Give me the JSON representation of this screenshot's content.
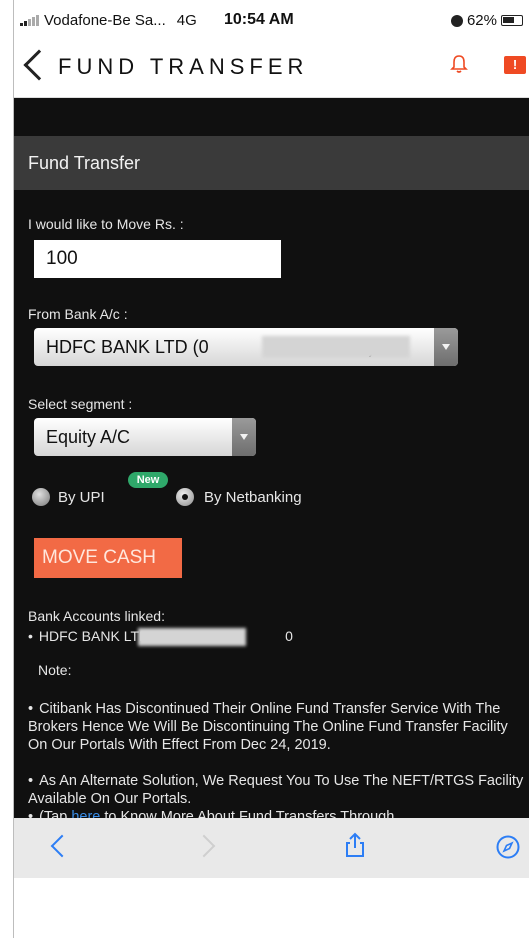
{
  "status_bar": {
    "carrier": "Vodafone-Be Sa...",
    "network": "4G",
    "time": "10:54 AM",
    "battery": "62%"
  },
  "nav": {
    "title": "FUND TRANSFER"
  },
  "form": {
    "section_title": "Fund Transfer",
    "amount_label": "I would like to Move Rs. :",
    "amount_value": "100",
    "from_bank_label": "From Bank A/c :",
    "from_bank_prefix": "HDFC BANK LTD (0",
    "from_bank_suffix": "0)",
    "segment_label": "Select segment :",
    "segment_value": "Equity A/C",
    "radio_upi_label": "By UPI",
    "new_badge": "New",
    "radio_netbanking_label": "By Netbanking",
    "move_cash_label": "MOVE CASH"
  },
  "linked": {
    "heading": "Bank Accounts linked:",
    "account_prefix": "HDFC BANK LTD - 00",
    "account_suffix": "0"
  },
  "note": {
    "heading": "Note:",
    "para1": "Citibank Has Discontinued Their Online Fund Transfer Service With The Brokers Hence We Will Be Discontinuing The Online Fund Transfer Facility On Our Portals With Effect From Dec 24, 2019.",
    "para2": "As An Alternate Solution, We Request You To Use The NEFT/RTGS Facility Available On Our Portals.",
    "para3_prefix": "(Tap ",
    "para3_link": "here",
    "para3_suffix": " to Know More About Fund Transfers Through"
  },
  "colors": {
    "accent": "#f26a45",
    "link": "#3b8ee8",
    "badge": "#2fa86a",
    "browser_tint": "#2d7ef5"
  },
  "icons": {
    "back": "chevron-left-icon",
    "notifications": "bell-icon",
    "alert": "alert-icon",
    "browser_share": "share-icon",
    "browser_compass": "compass-icon"
  }
}
